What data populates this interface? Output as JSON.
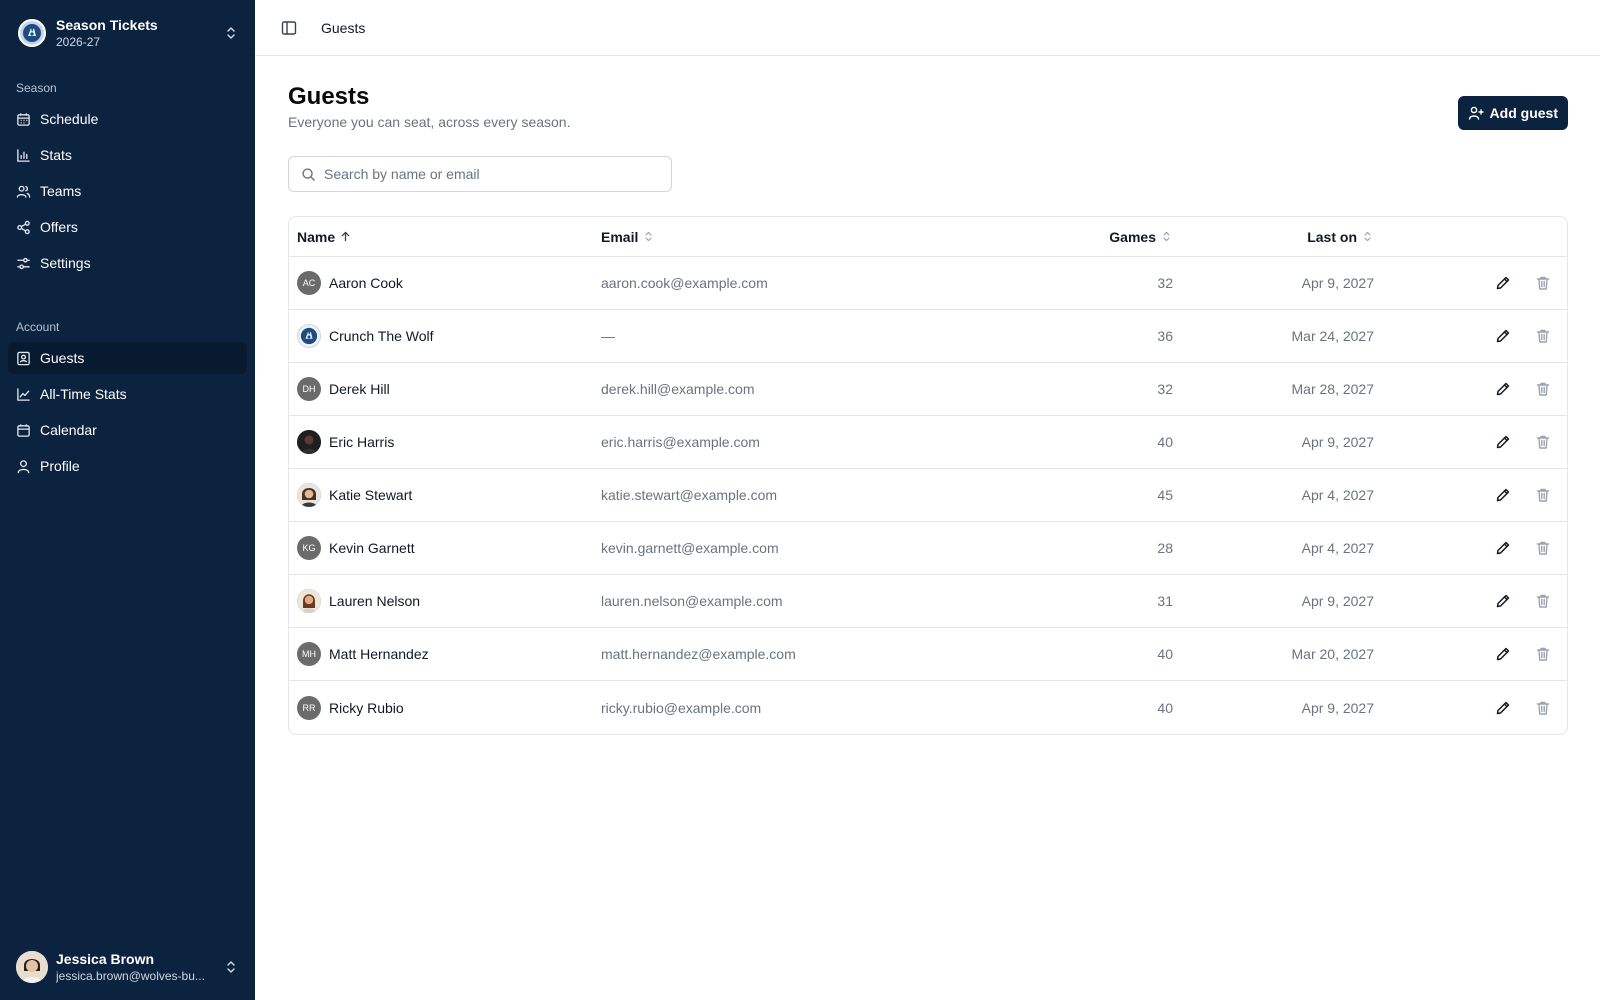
{
  "sidebar": {
    "brand": {
      "title": "Season Tickets",
      "subtitle": "2026-27",
      "logo_icon": "wolf-logo-icon"
    },
    "sections": [
      {
        "label": "Season",
        "items": [
          {
            "label": "Schedule",
            "icon": "calendar-grid-icon"
          },
          {
            "label": "Stats",
            "icon": "bar-chart-icon"
          },
          {
            "label": "Teams",
            "icon": "users-icon"
          },
          {
            "label": "Offers",
            "icon": "share-icon"
          },
          {
            "label": "Settings",
            "icon": "sliders-icon"
          }
        ]
      },
      {
        "label": "Account",
        "items": [
          {
            "label": "Guests",
            "icon": "contact-icon",
            "active": true
          },
          {
            "label": "All-Time Stats",
            "icon": "line-chart-icon"
          },
          {
            "label": "Calendar",
            "icon": "calendar-icon"
          },
          {
            "label": "Profile",
            "icon": "user-icon"
          }
        ]
      }
    ],
    "user": {
      "name": "Jessica Brown",
      "email": "jessica.brown@wolves-bu..."
    }
  },
  "topbar": {
    "breadcrumb": "Guests"
  },
  "page": {
    "title": "Guests",
    "subtitle": "Everyone you can seat, across every season.",
    "add_button": "Add guest",
    "search_placeholder": "Search by name or email"
  },
  "table": {
    "columns": {
      "name": "Name",
      "email": "Email",
      "games": "Games",
      "last_on": "Last on"
    },
    "sort": {
      "column": "name",
      "direction": "ascending"
    },
    "rows": [
      {
        "name": "Aaron Cook",
        "initials": "AC",
        "avatar": "initials",
        "email": "aaron.cook@example.com",
        "games": "32",
        "last_on": "Apr 9, 2027"
      },
      {
        "name": "Crunch The Wolf",
        "initials": "",
        "avatar": "logo",
        "email": "—",
        "games": "36",
        "last_on": "Mar 24, 2027"
      },
      {
        "name": "Derek Hill",
        "initials": "DH",
        "avatar": "initials",
        "email": "derek.hill@example.com",
        "games": "32",
        "last_on": "Mar 28, 2027"
      },
      {
        "name": "Eric Harris",
        "initials": "",
        "avatar": "photo-dark",
        "email": "eric.harris@example.com",
        "games": "40",
        "last_on": "Apr 9, 2027"
      },
      {
        "name": "Katie Stewart",
        "initials": "",
        "avatar": "photo-light",
        "email": "katie.stewart@example.com",
        "games": "45",
        "last_on": "Apr 4, 2027"
      },
      {
        "name": "Kevin Garnett",
        "initials": "KG",
        "avatar": "initials",
        "email": "kevin.garnett@example.com",
        "games": "28",
        "last_on": "Apr 4, 2027"
      },
      {
        "name": "Lauren Nelson",
        "initials": "",
        "avatar": "photo-warm",
        "email": "lauren.nelson@example.com",
        "games": "31",
        "last_on": "Apr 9, 2027"
      },
      {
        "name": "Matt Hernandez",
        "initials": "MH",
        "avatar": "initials",
        "email": "matt.hernandez@example.com",
        "games": "40",
        "last_on": "Mar 20, 2027"
      },
      {
        "name": "Ricky Rubio",
        "initials": "RR",
        "avatar": "initials",
        "email": "ricky.rubio@example.com",
        "games": "40",
        "last_on": "Apr 9, 2027"
      }
    ]
  },
  "colors": {
    "sidebar_bg": "#0c2340",
    "accent": "#0c2340",
    "active_item": "#071a30"
  }
}
